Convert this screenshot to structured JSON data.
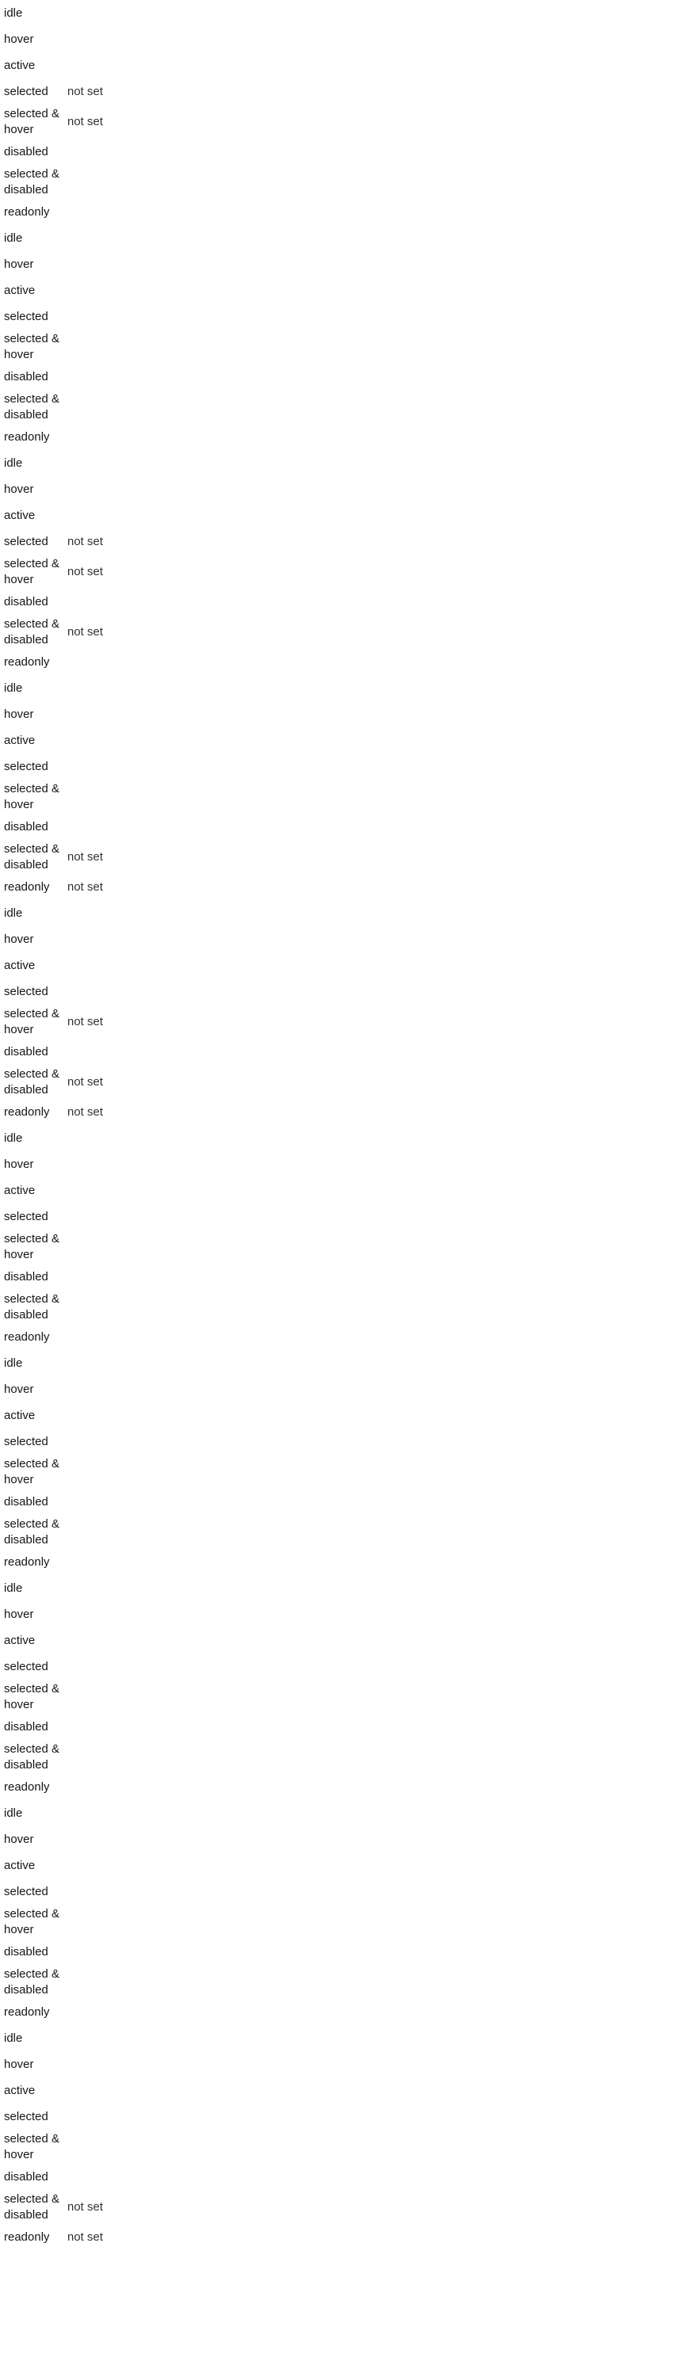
{
  "groups": [
    {
      "rows": [
        {
          "label": "idle",
          "value": ""
        },
        {
          "label": "hover",
          "value": ""
        },
        {
          "label": "active",
          "value": ""
        },
        {
          "label": "selected",
          "value": "not set"
        },
        {
          "label": "selected & hover",
          "value": "not set"
        },
        {
          "label": "disabled",
          "value": ""
        },
        {
          "label": "selected & disabled",
          "value": ""
        },
        {
          "label": "readonly",
          "value": ""
        }
      ]
    },
    {
      "rows": [
        {
          "label": "idle",
          "value": ""
        },
        {
          "label": "hover",
          "value": ""
        },
        {
          "label": "active",
          "value": ""
        },
        {
          "label": "selected",
          "value": ""
        },
        {
          "label": "selected & hover",
          "value": ""
        },
        {
          "label": "disabled",
          "value": ""
        },
        {
          "label": "selected & disabled",
          "value": ""
        },
        {
          "label": "readonly",
          "value": ""
        }
      ]
    },
    {
      "rows": [
        {
          "label": "idle",
          "value": ""
        },
        {
          "label": "hover",
          "value": ""
        },
        {
          "label": "active",
          "value": ""
        },
        {
          "label": "selected",
          "value": "not set"
        },
        {
          "label": "selected & hover",
          "value": "not set"
        },
        {
          "label": "disabled",
          "value": ""
        },
        {
          "label": "selected & disabled",
          "value": "not set"
        },
        {
          "label": "readonly",
          "value": ""
        }
      ]
    },
    {
      "rows": [
        {
          "label": "idle",
          "value": ""
        },
        {
          "label": "hover",
          "value": ""
        },
        {
          "label": "active",
          "value": ""
        },
        {
          "label": "selected",
          "value": ""
        },
        {
          "label": "selected & hover",
          "value": ""
        },
        {
          "label": "disabled",
          "value": ""
        },
        {
          "label": "selected & disabled",
          "value": "not set"
        },
        {
          "label": "readonly",
          "value": "not set"
        }
      ]
    },
    {
      "rows": [
        {
          "label": "idle",
          "value": ""
        },
        {
          "label": "hover",
          "value": ""
        },
        {
          "label": "active",
          "value": ""
        },
        {
          "label": "selected",
          "value": ""
        },
        {
          "label": "selected & hover",
          "value": "not set"
        },
        {
          "label": "disabled",
          "value": ""
        },
        {
          "label": "selected & disabled",
          "value": "not set"
        },
        {
          "label": "readonly",
          "value": "not set"
        }
      ]
    },
    {
      "rows": [
        {
          "label": "idle",
          "value": ""
        },
        {
          "label": "hover",
          "value": ""
        },
        {
          "label": "active",
          "value": ""
        },
        {
          "label": "selected",
          "value": ""
        },
        {
          "label": "selected & hover",
          "value": ""
        },
        {
          "label": "disabled",
          "value": ""
        },
        {
          "label": "selected & disabled",
          "value": ""
        },
        {
          "label": "readonly",
          "value": ""
        }
      ]
    },
    {
      "rows": [
        {
          "label": "idle",
          "value": ""
        },
        {
          "label": "hover",
          "value": ""
        },
        {
          "label": "active",
          "value": ""
        },
        {
          "label": "selected",
          "value": ""
        },
        {
          "label": "selected & hover",
          "value": ""
        },
        {
          "label": "disabled",
          "value": ""
        },
        {
          "label": "selected & disabled",
          "value": ""
        },
        {
          "label": "readonly",
          "value": ""
        }
      ]
    },
    {
      "rows": [
        {
          "label": "idle",
          "value": ""
        },
        {
          "label": "hover",
          "value": ""
        },
        {
          "label": "active",
          "value": ""
        },
        {
          "label": "selected",
          "value": ""
        },
        {
          "label": "selected & hover",
          "value": ""
        },
        {
          "label": "disabled",
          "value": ""
        },
        {
          "label": "selected & disabled",
          "value": ""
        },
        {
          "label": "readonly",
          "value": ""
        }
      ]
    },
    {
      "rows": [
        {
          "label": "idle",
          "value": ""
        },
        {
          "label": "hover",
          "value": ""
        },
        {
          "label": "active",
          "value": ""
        },
        {
          "label": "selected",
          "value": ""
        },
        {
          "label": "selected & hover",
          "value": ""
        },
        {
          "label": "disabled",
          "value": ""
        },
        {
          "label": "selected & disabled",
          "value": ""
        },
        {
          "label": "readonly",
          "value": ""
        }
      ]
    },
    {
      "rows": [
        {
          "label": "idle",
          "value": ""
        },
        {
          "label": "hover",
          "value": ""
        },
        {
          "label": "active",
          "value": ""
        },
        {
          "label": "selected",
          "value": ""
        },
        {
          "label": "selected & hover",
          "value": ""
        },
        {
          "label": "disabled",
          "value": ""
        },
        {
          "label": "selected & disabled",
          "value": "not set"
        },
        {
          "label": "readonly",
          "value": "not set"
        }
      ]
    }
  ]
}
